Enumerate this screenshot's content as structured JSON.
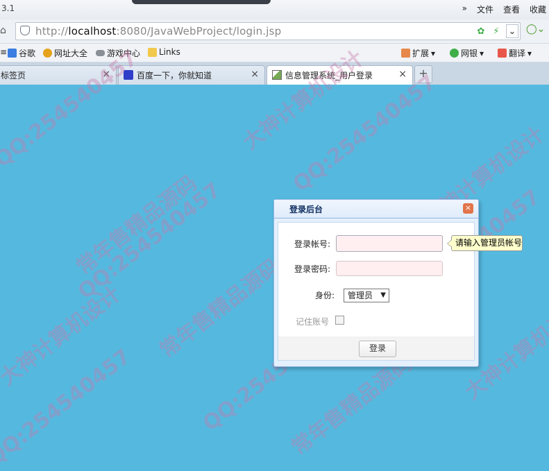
{
  "browser": {
    "version_fragment": "3.1",
    "menu": [
      "»",
      "文件",
      "查看",
      "收藏"
    ],
    "address": {
      "scheme": "http://",
      "host": "localhost",
      "rest": ":8080/JavaWebProject/login.jsp"
    },
    "bookmarks": [
      "谷歌",
      "网址大全",
      "游戏中心",
      "Links"
    ],
    "toolbar_right": [
      "扩展",
      "网银",
      "翻译"
    ],
    "tabs": [
      {
        "label": "标签页",
        "active": false
      },
      {
        "label": "百度一下，你就知道",
        "active": false
      },
      {
        "label": "信息管理系统_用户登录",
        "active": true
      }
    ],
    "new_tab": "+",
    "tab_close": "×"
  },
  "dialog": {
    "title": "登录后台",
    "close": "×",
    "account_label": "登录帐号:",
    "password_label": "登录密码:",
    "role_label": "身份:",
    "role_value": "管理员",
    "remember_label": "记住账号",
    "login_button": "登录",
    "tooltip": "请输入管理员帐号"
  },
  "colors": {
    "page_bg": "#55b9df",
    "input_bg": "#ffeff0",
    "tooltip_bg": "#ffffcc"
  },
  "watermarks": [
    "QQ:254540457",
    "大神计算机设计",
    "常年售精品源码"
  ]
}
